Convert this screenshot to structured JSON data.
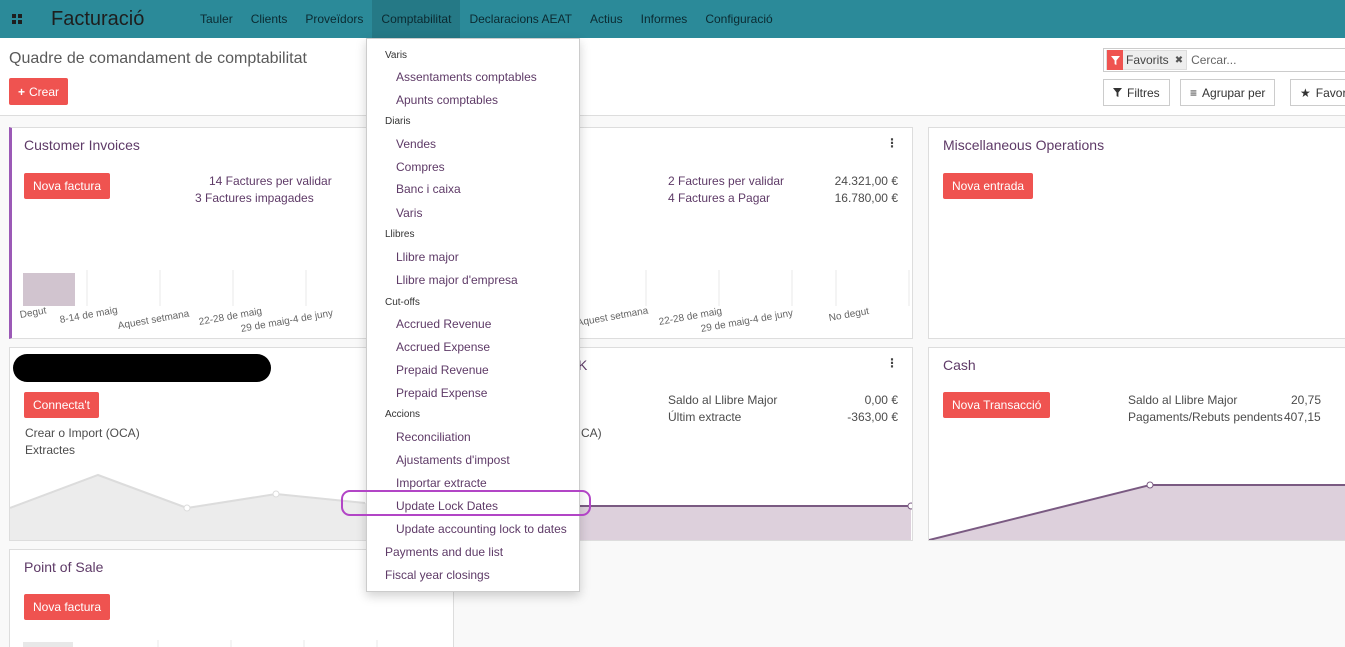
{
  "navbar": {
    "brand": "Facturació",
    "menu": [
      "Tauler",
      "Clients",
      "Proveïdors",
      "Comptabilitat",
      "Declaracions AEAT",
      "Actius",
      "Informes",
      "Configuració"
    ],
    "active_menu": "Comptabilitat"
  },
  "control": {
    "title": "Quadre de comandament de comptabilitat",
    "create_label": "Crear",
    "search": {
      "facet": "Favorits",
      "placeholder": "Cercar..."
    },
    "filters_label": "Filtres",
    "group_label": "Agrupar per",
    "favorites_label": "Favori"
  },
  "cards": {
    "customer_invoices": {
      "title": "Customer Invoices",
      "button": "Nova factura",
      "links": [
        "14 Factures per validar",
        "3 Factures impagades"
      ],
      "ticks": [
        "Degut",
        "8-14 de maig",
        "Aquest setmana",
        "22-28 de maig",
        "29 de maig-4 de juny"
      ],
      "bars": [
        {
          "label": "Degut",
          "value": 1
        }
      ]
    },
    "vendor_bills": {
      "rows": [
        {
          "label": "2 Factures per validar",
          "amount": "24.321,00 €"
        },
        {
          "label": "4 Factures a Pagar",
          "amount": "16.780,00 €"
        }
      ],
      "ticks": [
        "Aquest setmana",
        "22-28 de maig",
        "29 de maig-4 de juny",
        "No degut"
      ]
    },
    "misc": {
      "title": "Miscellaneous Operations",
      "button": "Nova entrada"
    },
    "bank1": {
      "button": "Connecta't",
      "texts": [
        "Crear o Import (OCA)",
        "Extractes"
      ]
    },
    "bank2": {
      "title_suffix": "K",
      "text_suffix": "CA)",
      "rows": [
        {
          "label": "Saldo al Llibre Major",
          "amount": "0,00 €"
        },
        {
          "label": "Últim extracte",
          "amount": "-363,00 €"
        }
      ]
    },
    "cash": {
      "title": "Cash",
      "button": "Nova Transacció",
      "rows": [
        {
          "label": "Saldo al Llibre Major",
          "amount": "20,75"
        },
        {
          "label": "Pagaments/Rebuts pendents",
          "amount": "407,15"
        }
      ]
    },
    "pos": {
      "title": "Point of Sale",
      "button": "Nova factura"
    }
  },
  "dropdown": {
    "sections": [
      {
        "header": "Varis",
        "items": [
          "Assentaments comptables",
          "Apunts comptables"
        ]
      },
      {
        "header": "Diaris",
        "items": [
          "Vendes",
          "Compres",
          "Banc i caixa",
          "Varis"
        ]
      },
      {
        "header": "Llibres",
        "items": [
          "Llibre major",
          "Llibre major d'empresa"
        ]
      },
      {
        "header": "Cut-offs",
        "items": [
          "Accrued Revenue",
          "Accrued Expense",
          "Prepaid Revenue",
          "Prepaid Expense"
        ]
      },
      {
        "header": "Accions",
        "items": [
          "Reconciliation",
          "Ajustaments d'impost",
          "Importar extracte",
          "Update Lock Dates",
          "Update accounting lock to dates"
        ]
      }
    ],
    "top_items": [
      "Payments and due list",
      "Fiscal year closings"
    ],
    "highlighted": "Update Lock Dates"
  },
  "colors": {
    "navbar": "#2b8a99",
    "accent": "#ef5350",
    "link": "#5e3a67",
    "highlight": "#b245c6"
  }
}
